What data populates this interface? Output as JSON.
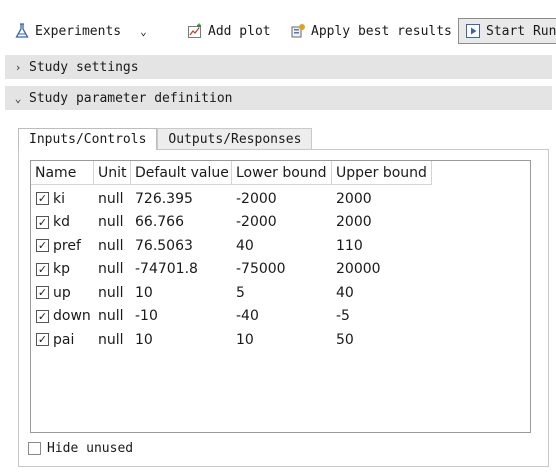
{
  "toolbar": {
    "experiments_label": "Experiments",
    "add_plot_label": "Add plot",
    "apply_best_label": "Apply best results",
    "start_run_label": "Start Run"
  },
  "sections": {
    "study_settings": "Study settings",
    "study_parameter_definition": "Study parameter definition"
  },
  "tabs": [
    {
      "label": "Inputs/Controls",
      "active": true
    },
    {
      "label": "Outputs/Responses",
      "active": false
    }
  ],
  "table": {
    "columns": [
      "Name",
      "Unit",
      "Default value",
      "Lower bound",
      "Upper bound"
    ],
    "rows": [
      {
        "checked": true,
        "name": "ki",
        "unit": "null",
        "default": "726.395",
        "lower": "-2000",
        "upper": "2000"
      },
      {
        "checked": true,
        "name": "kd",
        "unit": "null",
        "default": "66.766",
        "lower": "-2000",
        "upper": "2000"
      },
      {
        "checked": true,
        "name": "pref",
        "unit": "null",
        "default": "76.5063",
        "lower": "40",
        "upper": "110"
      },
      {
        "checked": true,
        "name": "kp",
        "unit": "null",
        "default": "-74701.8",
        "lower": "-75000",
        "upper": "20000"
      },
      {
        "checked": true,
        "name": "up",
        "unit": "null",
        "default": "10",
        "lower": "5",
        "upper": "40"
      },
      {
        "checked": true,
        "name": "down",
        "unit": "null",
        "default": "-10",
        "lower": "-40",
        "upper": "-5"
      },
      {
        "checked": true,
        "name": "pai",
        "unit": "null",
        "default": "10",
        "lower": "10",
        "upper": "50"
      }
    ]
  },
  "hide_unused": {
    "label": "Hide unused",
    "checked": false
  }
}
